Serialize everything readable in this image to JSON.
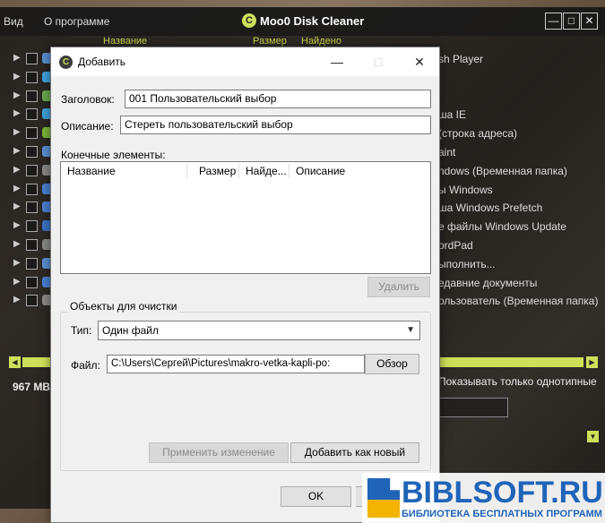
{
  "app": {
    "menu": [
      "Вид",
      "О программе"
    ],
    "title": "Moo0 Disk Cleaner",
    "logo_glyph": "C",
    "window_buttons": {
      "minimize": "—",
      "maximize": "□",
      "close": "✕"
    },
    "columns": {
      "name": "Название",
      "size": "Размер",
      "found": "Найдено"
    },
    "right_list": [
      "sh Player",
      "",
      "",
      "ша IE",
      "(строка адреса)",
      "aint",
      "ndows (Временная папка)",
      "ы Windows",
      "ша Windows Prefetch",
      "е файлы Windows Update",
      "ordPad",
      "ыполнить...",
      "едавние документы",
      "ользователь (Временная папка)"
    ],
    "status_size": "967 MB",
    "same_type_label": "Показывать только однотипные"
  },
  "dialog": {
    "title": "Добавить",
    "icon_glyph": "C",
    "window_buttons": {
      "minimize": "—",
      "maximize": "□",
      "close": "✕"
    },
    "heading_label": "Заголовок:",
    "heading_value": "001 Пользовательский выбор",
    "description_label": "Описание:",
    "description_value": "Стереть пользовательский выбор",
    "end_items_label": "Конечные элементы:",
    "list_columns": [
      "Название",
      "Размер",
      "Найде...",
      "Описание"
    ],
    "delete_button": "Удалить",
    "group_title": "Объекты для очистки",
    "type_label": "Тип:",
    "type_value": "Один файл",
    "file_label": "Файл:",
    "file_value": "C:\\Users\\Сергей\\Pictures\\makro-vetka-kapli-po:",
    "browse_button": "Обзор",
    "apply_button": "Применить изменение",
    "add_new_button": "Добавить как новый",
    "ok_button": "OK"
  },
  "watermark": {
    "name": "BIBLSOFT.RU",
    "subtitle": "БИБЛИОТЕКА БЕСПЛАТНЫХ ПРОГРАММ"
  },
  "icons": [
    "play-arrow-icon",
    "checkbox-icon",
    "app-logo-icon",
    "chevron-down-icon",
    "scroll-left-icon",
    "scroll-right-icon",
    "scroll-down-icon"
  ]
}
